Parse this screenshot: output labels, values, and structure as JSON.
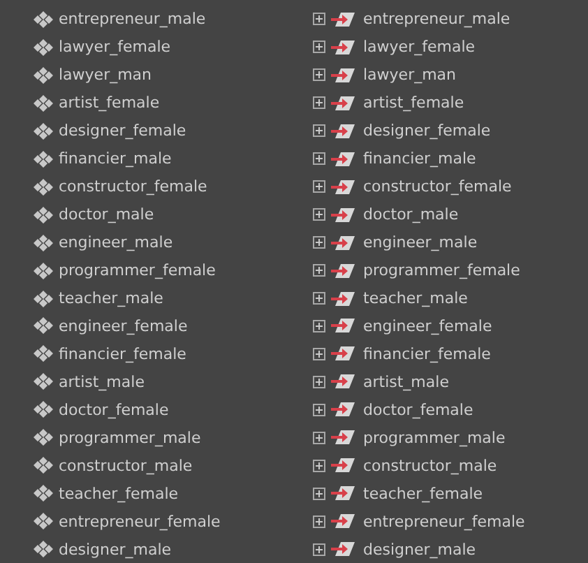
{
  "left_list": {
    "items": [
      {
        "label": "entrepreneur_male"
      },
      {
        "label": "lawyer_female"
      },
      {
        "label": "lawyer_man"
      },
      {
        "label": "artist_female"
      },
      {
        "label": "designer_female"
      },
      {
        "label": "financier_male"
      },
      {
        "label": "constructor_female"
      },
      {
        "label": "doctor_male"
      },
      {
        "label": "engineer_male"
      },
      {
        "label": "programmer_female"
      },
      {
        "label": "teacher_male"
      },
      {
        "label": "engineer_female"
      },
      {
        "label": "financier_female"
      },
      {
        "label": "artist_male"
      },
      {
        "label": "doctor_female"
      },
      {
        "label": "programmer_male"
      },
      {
        "label": "constructor_male"
      },
      {
        "label": "teacher_female"
      },
      {
        "label": "entrepreneur_female"
      },
      {
        "label": "designer_male"
      }
    ]
  },
  "right_tree": {
    "items": [
      {
        "label": "entrepreneur_male",
        "expanded": false
      },
      {
        "label": "lawyer_female",
        "expanded": false
      },
      {
        "label": "lawyer_man",
        "expanded": false
      },
      {
        "label": "artist_female",
        "expanded": false
      },
      {
        "label": "designer_female",
        "expanded": false
      },
      {
        "label": "financier_male",
        "expanded": false
      },
      {
        "label": "constructor_female",
        "expanded": false
      },
      {
        "label": "doctor_male",
        "expanded": false
      },
      {
        "label": "engineer_male",
        "expanded": false
      },
      {
        "label": "programmer_female",
        "expanded": false
      },
      {
        "label": "teacher_male",
        "expanded": false
      },
      {
        "label": "engineer_female",
        "expanded": false
      },
      {
        "label": "financier_female",
        "expanded": false
      },
      {
        "label": "artist_male",
        "expanded": false
      },
      {
        "label": "doctor_female",
        "expanded": false
      },
      {
        "label": "programmer_male",
        "expanded": false
      },
      {
        "label": "constructor_male",
        "expanded": false
      },
      {
        "label": "teacher_female",
        "expanded": false
      },
      {
        "label": "entrepreneur_female",
        "expanded": false
      },
      {
        "label": "designer_male",
        "expanded": false
      }
    ]
  }
}
